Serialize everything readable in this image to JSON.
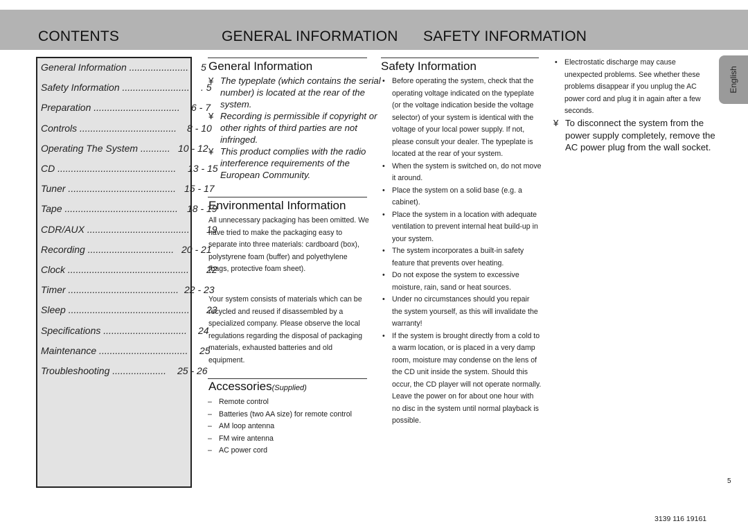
{
  "header": {
    "contents": "CONTENTS",
    "general": "GENERAL INFORMATION",
    "safety": "SAFETY INFORMATION"
  },
  "toc": [
    {
      "label": "General Information ........................",
      "page": "5"
    },
    {
      "label": "Safety Information ..........................",
      "page": ". 5"
    },
    {
      "label": "Preparation ................................",
      "page": "6 - 7"
    },
    {
      "label": "Controls ....................................",
      "page": "8 - 10"
    },
    {
      "label": "Operating The System ...........",
      "page": "10 - 12"
    },
    {
      "label": "CD ............................................",
      "page": "13 - 15"
    },
    {
      "label": "Tuner ........................................",
      "page": "15 - 17"
    },
    {
      "label": "Tape ..........................................",
      "page": "18 - 19"
    },
    {
      "label": "CDR/AUX .........................................",
      "page": "19"
    },
    {
      "label": "Recording ................................",
      "page": "20 - 21"
    },
    {
      "label": "Clock ...............................................",
      "page": "22"
    },
    {
      "label": "Timer .........................................",
      "page": "22 - 23"
    },
    {
      "label": "Sleep ..............................................",
      "page": "23"
    },
    {
      "label": "Specifications ...............................",
      "page": "24"
    },
    {
      "label": "Maintenance .................................",
      "page": "25"
    },
    {
      "label": "Troubleshooting ....................",
      "page": "25 - 26"
    }
  ],
  "general_information": {
    "title": "General Information",
    "bullet_glyph": "¥",
    "items": [
      "The typeplate (which contains the serial number) is located at the rear of the system.",
      "Recording is permissible if copyright or other rights of third parties are not infringed.",
      "This product complies with the radio interference requirements of the European Community."
    ]
  },
  "environmental_information": {
    "title": "Environmental Information",
    "paragraphs": [
      "All unnecessary packaging has been omitted. We have tried to make the packaging easy to separate into three materials: cardboard (box), polystyrene foam (buffer) and polyethylene (bags, protective foam sheet).",
      "Your system consists of materials which can be recycled and reused if disassembled by a specialized company. Please observe the local regulations regarding the disposal of packaging materials, exhausted batteries and old equipment."
    ]
  },
  "accessories": {
    "title": "Accessories",
    "subtitle": "(Supplied)",
    "bullet_glyph": "–",
    "items": [
      "Remote control",
      "Batteries (two AA size) for remote control",
      "AM loop antenna",
      "FM wire antenna",
      "AC power cord"
    ]
  },
  "safety_information": {
    "title": "Safety Information",
    "bullet_glyph": "•",
    "items": [
      "Before operating the system, check that the operating voltage indicated on the typeplate (or the voltage indication beside the voltage selector) of your system is identical with the voltage of your local power supply. If not, please consult your dealer. The typeplate is located at the rear of your system.",
      "When the system is switched on, do not move it around.",
      "Place the system on a solid base (e.g. a cabinet).",
      "Place the system in a location with adequate ventilation to prevent internal heat build-up in your system.",
      "The system incorporates a built-in safety feature that prevents over heating.",
      "Do not expose the system to excessive moisture, rain, sand or heat sources.",
      "Under no circumstances should you repair the system yourself, as this will invalidate the warranty!",
      "If the system is brought directly from a cold to a warm location, or is placed in a very damp room, moisture may condense on the lens of the CD unit inside the system. Should this occur, the CD player will not operate normally. Leave the power on for about one hour with no disc in the system until normal playback is possible."
    ],
    "col4_items": [
      "Electrostatic discharge may cause unexpected problems. See whether these problems disappear if you unplug the AC power cord and plug it in again after a few seconds."
    ],
    "note_glyph": "¥",
    "note": "To disconnect the system from the power supply completely, remove the AC power plug from the wall socket."
  },
  "language_tab": "English",
  "page_number": "5",
  "document_code": "3139 116 19161"
}
